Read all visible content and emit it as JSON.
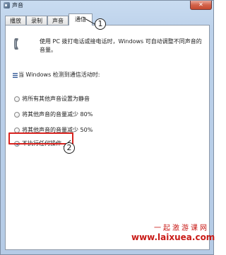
{
  "window": {
    "title": "声音",
    "close_label": "✕"
  },
  "tabs": [
    {
      "label": "播放",
      "active": false
    },
    {
      "label": "录制",
      "active": false
    },
    {
      "label": "声音",
      "active": false
    },
    {
      "label": "通信",
      "active": true
    }
  ],
  "communications": {
    "description": "使用 PC 拨打电话或接电话时，Windows 可自动调整不同声音的音量。",
    "section_label": "当 Windows 检测到通信活动时:",
    "options": [
      {
        "label": "将所有其他声音设置为静音",
        "checked": false
      },
      {
        "label": "将其他声音的音量减少 80%",
        "checked": false
      },
      {
        "label": "将其他声音的音量减少 50%",
        "checked": false
      },
      {
        "label": "不执行任何操作",
        "checked": true
      }
    ]
  },
  "annotations": {
    "callout_1": "1",
    "callout_2": "2",
    "highlight_color": "#d8231f"
  },
  "watermark": {
    "text": "一起激游课网",
    "url": "www.laixuea.com",
    "color": "#c91b17"
  },
  "icons": {
    "app": "speaker-icon",
    "phone": "telephone-handset-icon",
    "section": "info-icon"
  }
}
